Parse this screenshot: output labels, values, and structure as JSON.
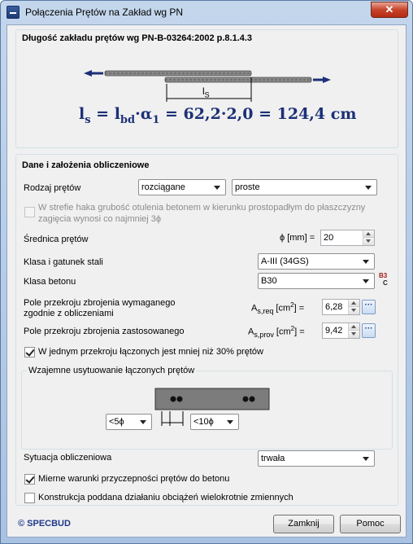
{
  "window": {
    "title": "Połączenia Prętów na Zakład wg PN",
    "close_symbol": "✕"
  },
  "header": {
    "section_title": "Długość zakładu prętów wg PN-B-03264:2002 p.8.1.4.3",
    "ls_label_main": "l",
    "ls_label_sub": "S",
    "formula": {
      "ls_main": "l",
      "ls_sub": "s",
      "eq1": " = ",
      "lbd_main": "l",
      "lbd_sub": "bd",
      "dot1": "·",
      "alpha_main": "α",
      "alpha_sub": "1",
      "rest": " = 62,2·2,0 = 124,4 cm"
    }
  },
  "data_section": {
    "title": "Dane i założenia obliczeniowe",
    "bar_type": {
      "label": "Rodzaj prętów",
      "value1": "rozciągane",
      "value2": "proste"
    },
    "hook_note": {
      "line1": "W strefie haka grubość otulenia betonem w kierunku prostopadłym do płaszczyzny",
      "line2": "zagięcia wynosi co najmniej 3ϕ"
    },
    "diameter": {
      "label": "Średnica prętów",
      "symbol": "ϕ [mm] =",
      "value": "20"
    },
    "steel_class": {
      "label": "Klasa i gatunek stali",
      "value": "A-III (34GS)"
    },
    "concrete_class": {
      "label": "Klasa betonu",
      "value": "B30",
      "icon_top": "B3",
      "icon_bottom": "C"
    },
    "as_req": {
      "label_line1": "Pole przekroju zbrojenia wymaganego",
      "label_line2": "zgodnie z obliczeniami",
      "symbol_main": "A",
      "symbol_sub": "s,req",
      "unit": "[cm",
      "unit_sup": "2",
      "unit_end": "] =",
      "value": "6,28",
      "dots": "···"
    },
    "as_prov": {
      "label": "Pole przekroju zbrojenia zastosowanego",
      "symbol_main": "A",
      "symbol_sub": "s,prov",
      "unit": "[cm",
      "unit_sup": "2",
      "unit_end": "] =",
      "value": "9,42",
      "dots": "···"
    },
    "less_than_30": {
      "label": "W jednym przekroju łączonych jest mniej niż 30% prętów",
      "checked": true
    }
  },
  "arrangement": {
    "title": "Wzajemne usytuowanie łączonych prętów",
    "spacing1": "<5ϕ",
    "spacing2": "<10ϕ"
  },
  "situation": {
    "label": "Sytuacja obliczeniowa",
    "value": "trwała"
  },
  "options": {
    "bond": {
      "label": "Mierne warunki przyczepności prętów do betonu",
      "checked": true
    },
    "repeated": {
      "label": "Konstrukcja poddana działaniu obciążeń wielokrotnie zmiennych",
      "checked": false
    }
  },
  "footer": {
    "brand": "© SPECBUD",
    "close_button": "Zamknij",
    "help_button": "Pomoc"
  },
  "colors": {
    "formula": "#1c3077",
    "brand": "#1e3a8a",
    "close": "#c7432b"
  }
}
